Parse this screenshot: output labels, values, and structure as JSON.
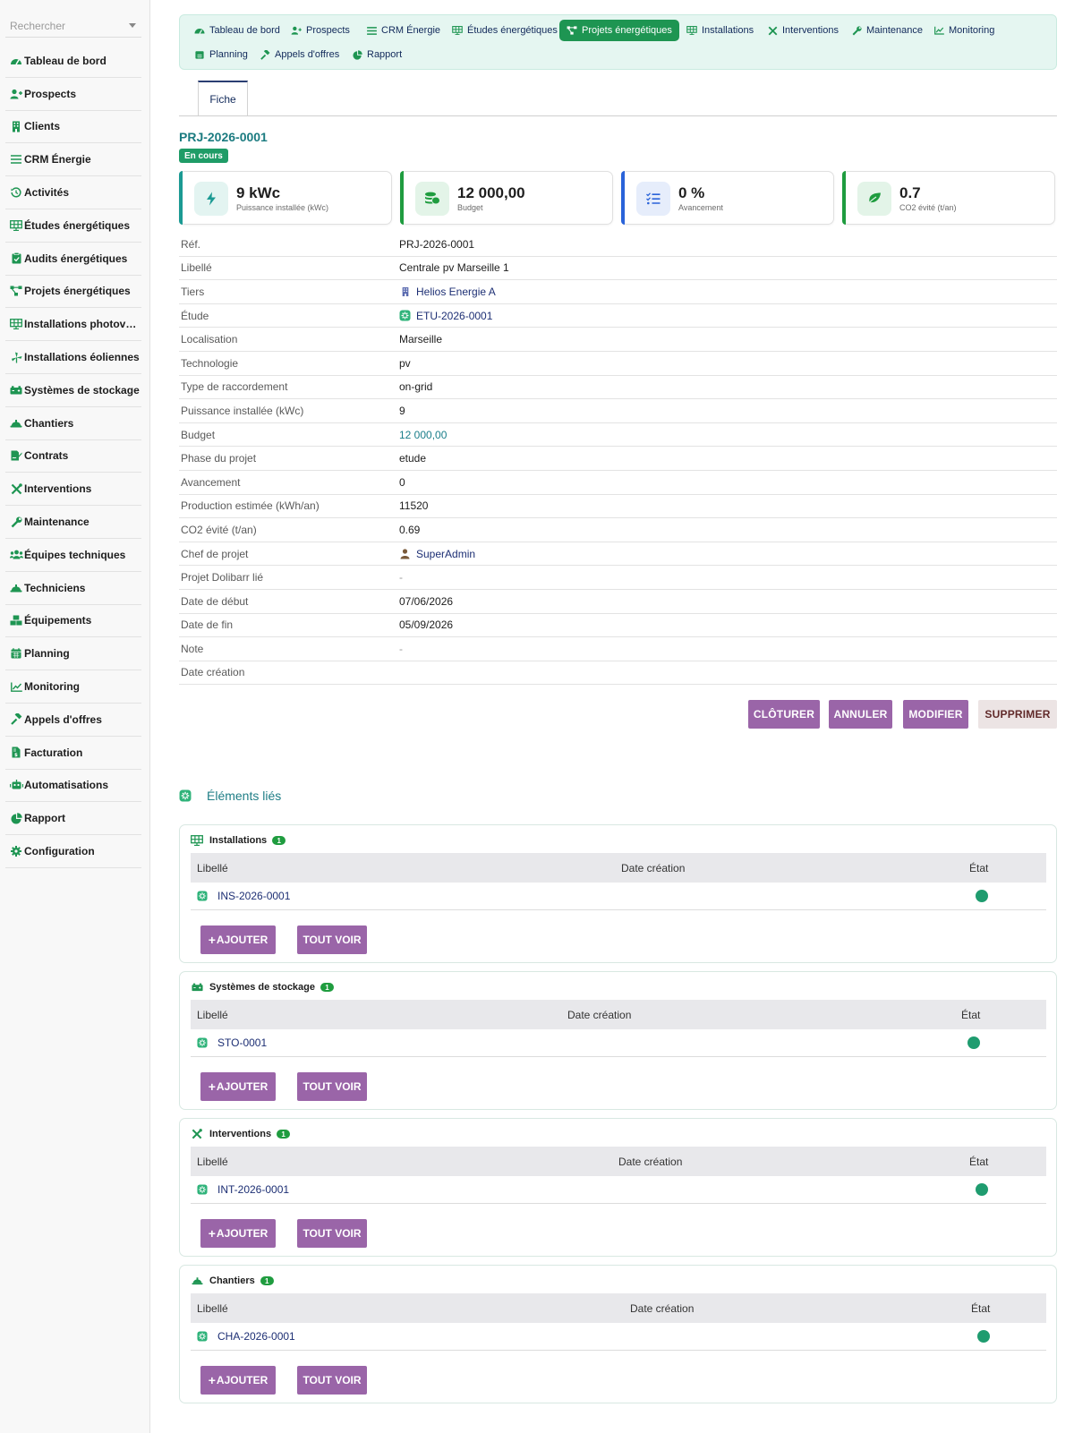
{
  "search": {
    "placeholder": "Rechercher"
  },
  "sidebar": {
    "items": [
      {
        "label": "Tableau de bord",
        "icon": "dashboard-icon"
      },
      {
        "label": "Prospects",
        "icon": "user-plus-icon"
      },
      {
        "label": "Clients",
        "icon": "building-icon"
      },
      {
        "label": "CRM Énergie",
        "icon": "list-icon"
      },
      {
        "label": "Activités",
        "icon": "history-icon"
      },
      {
        "label": "Études énergétiques",
        "icon": "solar-panel-icon"
      },
      {
        "label": "Audits énergétiques",
        "icon": "clipboard-check-icon"
      },
      {
        "label": "Projets énergétiques",
        "icon": "project-diagram-icon"
      },
      {
        "label": "Installations photov…",
        "icon": "solar-panel-icon"
      },
      {
        "label": "Installations éoliennes",
        "icon": "wind-icon"
      },
      {
        "label": "Systèmes de stockage",
        "icon": "battery-icon"
      },
      {
        "label": "Chantiers",
        "icon": "hard-hat-icon"
      },
      {
        "label": "Contrats",
        "icon": "file-signature-icon"
      },
      {
        "label": "Interventions",
        "icon": "tools-icon"
      },
      {
        "label": "Maintenance",
        "icon": "wrench-icon"
      },
      {
        "label": "Équipes techniques",
        "icon": "users-icon"
      },
      {
        "label": "Techniciens",
        "icon": "hard-hat-icon"
      },
      {
        "label": "Équipements",
        "icon": "boxes-icon"
      },
      {
        "label": "Planning",
        "icon": "calendar-icon"
      },
      {
        "label": "Monitoring",
        "icon": "chart-line-icon"
      },
      {
        "label": "Appels d'offres",
        "icon": "gavel-icon"
      },
      {
        "label": "Facturation",
        "icon": "invoice-icon"
      },
      {
        "label": "Automatisations",
        "icon": "robot-icon"
      },
      {
        "label": "Rapport",
        "icon": "pie-chart-icon"
      },
      {
        "label": "Configuration",
        "icon": "cog-icon"
      }
    ]
  },
  "topnav": {
    "tabs": [
      {
        "label": "Tableau de bord"
      },
      {
        "label": "Prospects"
      },
      {
        "label": "CRM Énergie"
      },
      {
        "label": "Études énergétiques"
      },
      {
        "label": "Projets énergétiques"
      },
      {
        "label": "Installations"
      },
      {
        "label": "Interventions"
      },
      {
        "label": "Maintenance"
      },
      {
        "label": "Monitoring"
      },
      {
        "label": "Planning"
      },
      {
        "label": "Appels d'offres"
      },
      {
        "label": "Rapport"
      }
    ]
  },
  "page": {
    "tab": "Fiche",
    "ref": "PRJ-2026-0001",
    "status": "En cours"
  },
  "colors": {
    "accent": "#1e9552",
    "teal": "#1b7b80",
    "button": "#9a65a8",
    "status_green": "#1f9c6f"
  },
  "kpis": [
    {
      "value": "9 kWc",
      "label": "Puissance installée (kWc)",
      "icon": "bolt-icon"
    },
    {
      "value": "12 000,00",
      "label": "Budget",
      "icon": "coins-icon"
    },
    {
      "value": "0 %",
      "label": "Avancement",
      "icon": "tasks-icon"
    },
    {
      "value": "0.7",
      "label": "CO2 évité (t/an)",
      "icon": "leaf-icon"
    }
  ],
  "details": [
    {
      "key": "Réf.",
      "value": "PRJ-2026-0001"
    },
    {
      "key": "Libellé",
      "value": "Centrale pv Marseille 1"
    },
    {
      "key": "Tiers",
      "value": "Helios Energie A"
    },
    {
      "key": "Étude",
      "value": "ETU-2026-0001"
    },
    {
      "key": "Localisation",
      "value": "Marseille"
    },
    {
      "key": "Technologie",
      "value": "pv"
    },
    {
      "key": "Type de raccordement",
      "value": "on-grid"
    },
    {
      "key": "Puissance installée (kWc)",
      "value": "9"
    },
    {
      "key": "Budget",
      "value": "12 000,00"
    },
    {
      "key": "Phase du projet",
      "value": "etude"
    },
    {
      "key": "Avancement",
      "value": "0"
    },
    {
      "key": "Production estimée (kWh/an)",
      "value": "11520"
    },
    {
      "key": "CO2 évité (t/an)",
      "value": "0.69"
    },
    {
      "key": "Chef de projet",
      "value": "SuperAdmin"
    },
    {
      "key": "Projet Dolibarr lié",
      "value": "-"
    },
    {
      "key": "Date de début",
      "value": "07/06/2026"
    },
    {
      "key": "Date de fin",
      "value": "05/09/2026"
    },
    {
      "key": "Note",
      "value": "-"
    },
    {
      "key": "Date création",
      "value": ""
    }
  ],
  "actions": {
    "close": "CLÔTURER",
    "cancel": "ANNULER",
    "edit": "MODIFIER",
    "delete": "SUPPRIMER"
  },
  "linked": {
    "title": "Éléments liés"
  },
  "related": [
    {
      "title": "Installations",
      "count": "1",
      "col_label": "Libellé",
      "col_date": "Date création",
      "col_state": "État",
      "row_label": "INS-2026-0001",
      "add": "AJOUTER",
      "view_all": "TOUT VOIR"
    },
    {
      "title": "Systèmes de stockage",
      "count": "1",
      "col_label": "Libellé",
      "col_date": "Date création",
      "col_state": "État",
      "row_label": "STO-0001",
      "add": "AJOUTER",
      "view_all": "TOUT VOIR"
    },
    {
      "title": "Interventions",
      "count": "1",
      "col_label": "Libellé",
      "col_date": "Date création",
      "col_state": "État",
      "row_label": "INT-2026-0001",
      "add": "AJOUTER",
      "view_all": "TOUT VOIR"
    },
    {
      "title": "Chantiers",
      "count": "1",
      "col_label": "Libellé",
      "col_date": "Date création",
      "col_state": "État",
      "row_label": "CHA-2026-0001",
      "add": "AJOUTER",
      "view_all": "TOUT VOIR"
    }
  ]
}
